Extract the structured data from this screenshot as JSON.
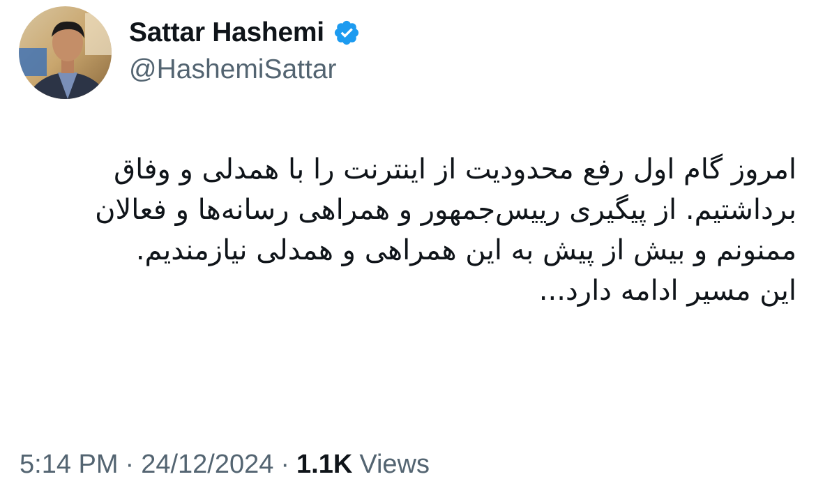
{
  "author": {
    "display_name": "Sattar Hashemi",
    "handle": "@HashemiSattar",
    "avatar_icon": "profile-photo",
    "verified_icon": "verified-badge-icon",
    "verified_color": "#1d9bf0"
  },
  "tweet": {
    "paragraph_1": "امروز گام اول رفع محدودیت از اینترنت را با همدلی و وفاق برداشتیم. از پیگیری رییس‌جمهور و همراهی رسانه‌ها و فعالان ممنونم و بیش از پیش به این همراهی و همدلی نیازمندیم.",
    "paragraph_2": "این مسیر ادامه دارد..."
  },
  "meta": {
    "time": "5:14 PM",
    "separator": "·",
    "date": "24/12/2024",
    "views_count": "1.1K",
    "views_label": "Views"
  },
  "colors": {
    "text_primary": "#0f1419",
    "text_secondary": "#536471",
    "accent": "#1d9bf0"
  }
}
